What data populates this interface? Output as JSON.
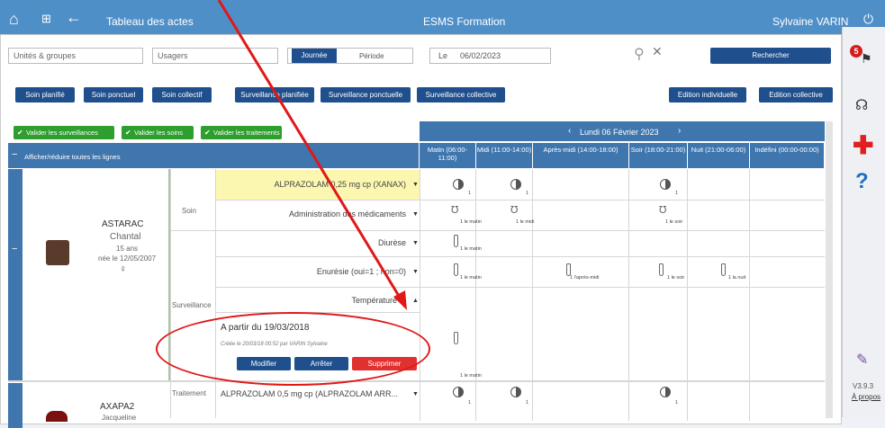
{
  "topbar": {
    "title": "Tableau des actes",
    "center": "ESMS Formation",
    "user": "Sylvaine VARIN"
  },
  "filters": {
    "units": "Unités & groupes",
    "users": "Usagers",
    "day": "Journée",
    "period": "Période",
    "le": "Le",
    "date": "06/02/2023",
    "search": "Rechercher"
  },
  "actions": [
    "Soin planifié",
    "Soin ponctuel",
    "Soin collectif",
    "Surveillance planifiée",
    "Surveillance ponctuelle",
    "Surveillance collective"
  ],
  "editions": [
    "Edition individuelle",
    "Edition collective"
  ],
  "validate": [
    "Valider les surveillances",
    "Valider les soins",
    "Valider les traitements"
  ],
  "toggle_all": "Afficher/réduire toutes les lignes",
  "day_nav": "Lundi 06 Février 2023",
  "columns": [
    "Matin (06:00-11:00)",
    "Midi (11:00-14:00)",
    "Après-midi (14:00-18:00)",
    "Soir (18:00-21:00)",
    "Nuit (21:00-06:00)",
    "Indéfini (00:00-00:00)"
  ],
  "patient1": {
    "last": "ASTARAC",
    "first": "Chantal",
    "age": "15 ans",
    "birth": "née le 12/05/2007",
    "sex": "♀"
  },
  "categories": {
    "soin": "Soin",
    "surveillance": "Surveillance",
    "traitement": "Traitement"
  },
  "rows": {
    "r1": "ALPRAZOLAM 0,25 mg cp (XANAX)",
    "r2": "Administration des médicaments",
    "r3": "Diurèse",
    "r4": "Enurésie (oui=1 ; non=0)",
    "r5": "Température",
    "r6": "ALPRAZOLAM 0,5 mg cp (ALPRAZOLAM ARR..."
  },
  "detail": {
    "from": "A partir du 19/03/2018",
    "created": "Créée le 20/03/18 00:52 par VARIN Sylvaine",
    "modify": "Modifier",
    "stop": "Arrêter",
    "delete": "Supprimer"
  },
  "cells": {
    "one": "1",
    "matin": "1 le matin",
    "midi": "1 le midi",
    "soir": "1 le soir",
    "apm": "1 l'après-midi",
    "nuit": "1 la nuit"
  },
  "patient2": {
    "last": "AXAPA2",
    "first": "Jacqueline"
  },
  "sidebar": {
    "badge": "5",
    "version": "V3.9.3",
    "about": "À propos"
  },
  "colors": {
    "header": "#4f8fc8",
    "navy": "#1f4f8c",
    "green": "#2e9e2e",
    "red": "#e03030",
    "highlight": "#fbf7b0"
  }
}
